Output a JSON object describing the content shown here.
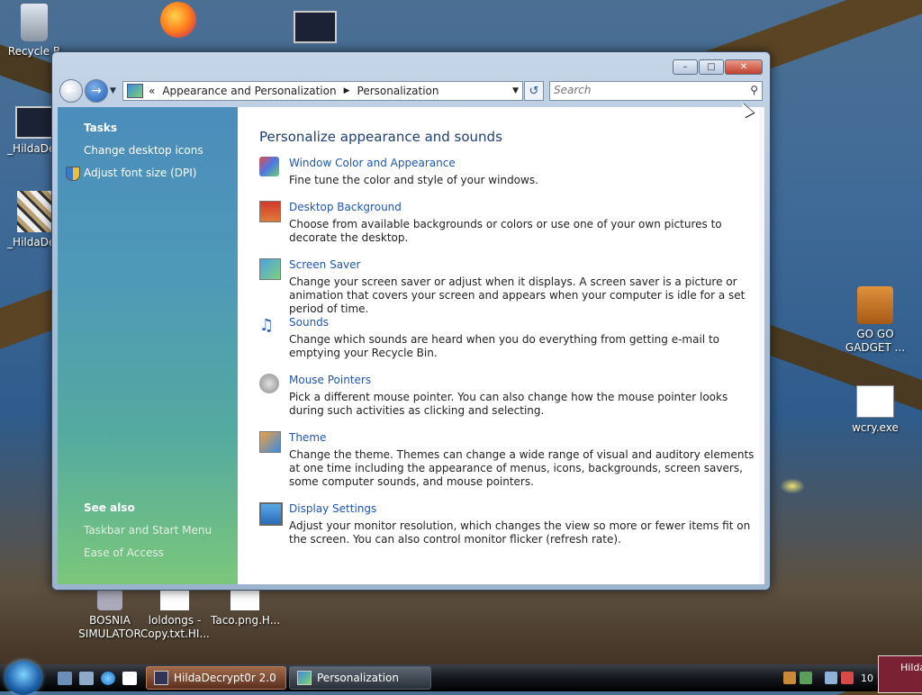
{
  "desktop": {
    "icons": [
      {
        "label": "Recycle B"
      },
      {
        "label": "_HildaDec"
      },
      {
        "label": "_HildaDec"
      },
      {
        "label": "GO GO GADGET ..."
      },
      {
        "label": "wcry.exe"
      },
      {
        "label": "BOSNIA SIMULATOR"
      },
      {
        "label": "loldongs - Copy.txt.HI..."
      },
      {
        "label": "Taco.png.H..."
      }
    ]
  },
  "window": {
    "breadcrumb": [
      "Appearance and Personalization",
      "Personalization"
    ],
    "breadcrumb_prefix": "«",
    "search_placeholder": "Search"
  },
  "left_pane": {
    "tasks_heading": "Tasks",
    "tasks": [
      "Change desktop icons",
      "Adjust font size (DPI)"
    ],
    "see_also_heading": "See also",
    "see_also": [
      "Taskbar and Start Menu",
      "Ease of Access"
    ]
  },
  "main": {
    "title": "Personalize appearance and sounds",
    "items": [
      {
        "title": "Window Color and Appearance",
        "desc": "Fine tune the color and style of your windows."
      },
      {
        "title": "Desktop Background",
        "desc": "Choose from available backgrounds or colors or use one of your own pictures to decorate the desktop."
      },
      {
        "title": "Screen Saver",
        "desc": "Change your screen saver or adjust when it displays. A screen saver is a picture or animation that covers your screen and appears when your computer is idle for a set period of time."
      },
      {
        "title": "Sounds",
        "desc": "Change which sounds are heard when you do everything from getting e-mail to emptying your Recycle Bin."
      },
      {
        "title": "Mouse Pointers",
        "desc": "Pick a different mouse pointer. You can also change how the mouse pointer looks during such activities as clicking and selecting."
      },
      {
        "title": "Theme",
        "desc": "Change the theme. Themes can change a wide range of visual and auditory elements at one time including the appearance of menus, icons, backgrounds, screen savers, some computer sounds, and mouse pointers."
      },
      {
        "title": "Display Settings",
        "desc": "Adjust your monitor resolution, which changes the view so more or fewer items fit on the screen. You can also control monitor flicker (refresh rate)."
      }
    ]
  },
  "taskbar": {
    "buttons": [
      {
        "label": "HildaDecrypt0r 2.0",
        "active": true
      },
      {
        "label": "Personalization",
        "active": false
      }
    ],
    "clock": "10",
    "peek_label": "Hilda"
  },
  "colors": {
    "link": "#1e56b3",
    "heading": "#1e3f73",
    "left_pane_top": "#4b8dbb",
    "left_pane_bottom": "#7bc77a"
  }
}
